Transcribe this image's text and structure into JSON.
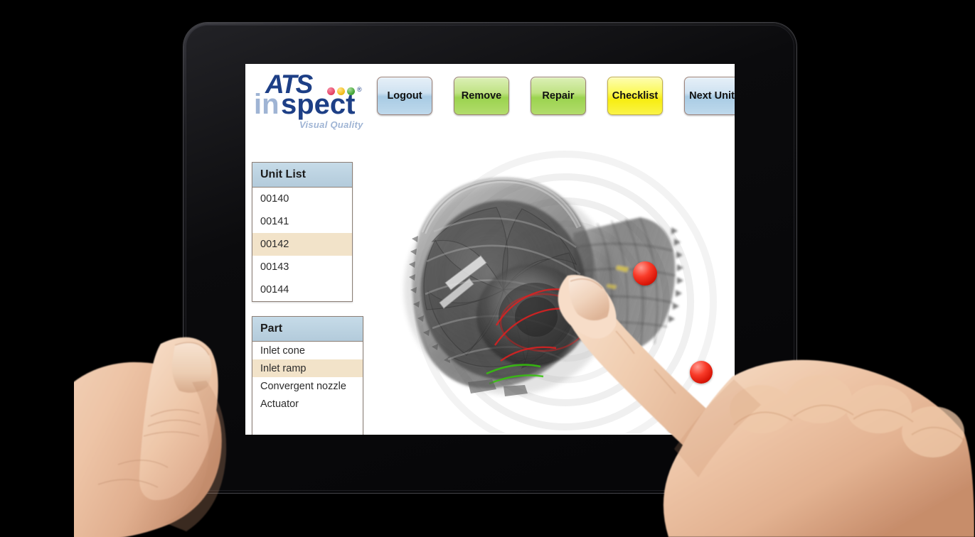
{
  "app": {
    "name": "ATS Inspect",
    "logo": {
      "brand": "ATS",
      "word_light": "in",
      "word_dark": "spect",
      "tagline": "Visual Quality",
      "registered_mark": "®",
      "dot_colors": [
        "#e8486a",
        "#f5c021",
        "#4aa93c"
      ],
      "brand_color": "#1d3f86",
      "brand_light_color": "#9fb4d4"
    }
  },
  "device": {
    "type": "tablet",
    "orientation": "landscape",
    "home_button": "home-button",
    "camera": "front-camera"
  },
  "toolbar": {
    "buttons": [
      {
        "label": "Logout",
        "style": "blue",
        "color": "#bfd9ec"
      },
      {
        "label": "Remove",
        "style": "green",
        "color": "#9bd34f"
      },
      {
        "label": "Repair",
        "style": "green",
        "color": "#9bd34f"
      },
      {
        "label": "Checklist",
        "style": "yellow",
        "color": "#f7ed12"
      },
      {
        "label": "Next Unit",
        "style": "blue",
        "color": "#bfd9ec"
      }
    ]
  },
  "unit_list": {
    "title": "Unit List",
    "selected": "00142",
    "items": [
      {
        "label": "00140",
        "selected": false
      },
      {
        "label": "00141",
        "selected": false
      },
      {
        "label": "00142",
        "selected": true
      },
      {
        "label": "00143",
        "selected": false
      },
      {
        "label": "00144",
        "selected": false
      }
    ]
  },
  "part_list": {
    "title": "Part",
    "selected": "Inlet ramp",
    "items": [
      {
        "label": "Inlet cone",
        "selected": false
      },
      {
        "label": "Inlet ramp",
        "selected": true
      },
      {
        "label": "Convergent nozzle",
        "selected": false
      },
      {
        "label": "Actuator",
        "selected": false
      }
    ]
  },
  "viewer": {
    "subject": "jet-engine-xray-3d-model",
    "selection_highlight_color": "#e02020",
    "markers": [
      {
        "id": "marker-red-top",
        "status": "defect",
        "color": "#ee2211"
      },
      {
        "id": "marker-red-center",
        "status": "defect",
        "color": "#ee2211"
      },
      {
        "id": "marker-green",
        "status": "ok",
        "color": "#4fc40a"
      }
    ],
    "touch_ripple": true
  },
  "selection_colors": {
    "row_highlight": "#f2e3c9",
    "panel_header": "#b3cbdb",
    "panel_border": "#8c7f76"
  }
}
